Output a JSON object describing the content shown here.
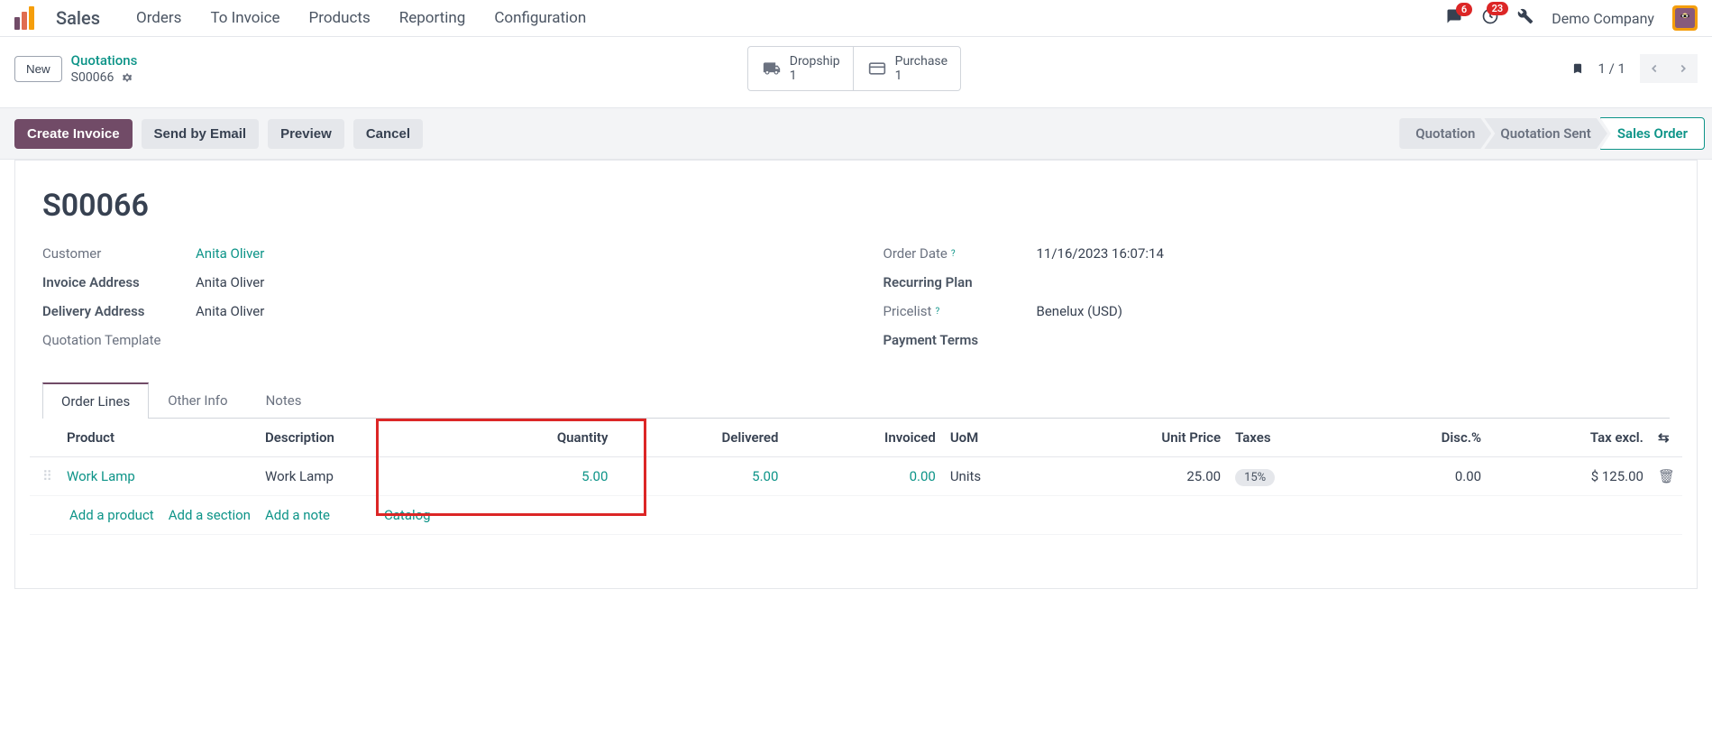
{
  "app": {
    "title": "Sales"
  },
  "nav": {
    "items": [
      "Orders",
      "To Invoice",
      "Products",
      "Reporting",
      "Configuration"
    ]
  },
  "header": {
    "messages_badge": "6",
    "activities_badge": "23",
    "company": "Demo Company"
  },
  "breadcrumb": {
    "new_label": "New",
    "parent": "Quotations",
    "record": "S00066"
  },
  "stat_buttons": [
    {
      "label": "Dropship",
      "value": "1"
    },
    {
      "label": "Purchase",
      "value": "1"
    }
  ],
  "pager": {
    "text": "1 / 1"
  },
  "actions": {
    "create_invoice": "Create Invoice",
    "send_email": "Send by Email",
    "preview": "Preview",
    "cancel": "Cancel"
  },
  "status": {
    "steps": [
      "Quotation",
      "Quotation Sent",
      "Sales Order"
    ]
  },
  "order": {
    "title": "S00066",
    "fields_left": {
      "customer_label": "Customer",
      "customer_value": "Anita Oliver",
      "invoice_addr_label": "Invoice Address",
      "invoice_addr_value": "Anita Oliver",
      "delivery_addr_label": "Delivery Address",
      "delivery_addr_value": "Anita Oliver",
      "template_label": "Quotation Template"
    },
    "fields_right": {
      "order_date_label": "Order Date",
      "order_date_value": "11/16/2023 16:07:14",
      "recurring_label": "Recurring Plan",
      "pricelist_label": "Pricelist",
      "pricelist_value": "Benelux (USD)",
      "payment_terms_label": "Payment Terms"
    }
  },
  "tabs": [
    "Order Lines",
    "Other Info",
    "Notes"
  ],
  "table": {
    "headers": {
      "product": "Product",
      "description": "Description",
      "quantity": "Quantity",
      "delivered": "Delivered",
      "invoiced": "Invoiced",
      "uom": "UoM",
      "unit_price": "Unit Price",
      "taxes": "Taxes",
      "disc": "Disc.%",
      "tax_excl": "Tax excl."
    },
    "rows": [
      {
        "product": "Work Lamp",
        "description": "Work Lamp",
        "quantity": "5.00",
        "delivered": "5.00",
        "invoiced": "0.00",
        "uom": "Units",
        "unit_price": "25.00",
        "taxes": "15%",
        "disc": "0.00",
        "tax_excl": "$ 125.00"
      }
    ],
    "footer": {
      "add_product": "Add a product",
      "add_section": "Add a section",
      "add_note": "Add a note",
      "catalog": "Catalog"
    }
  }
}
